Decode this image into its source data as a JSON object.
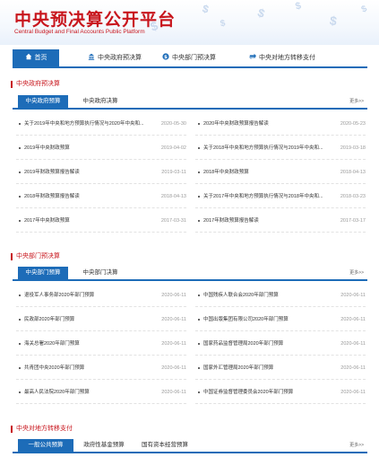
{
  "header": {
    "title": "中央预决算公开平台",
    "subtitle": "Central Budget and Final Accounts Public Platform",
    "colors": {
      "brand_red": "#c8161d",
      "accent_blue": "#1d6cb8"
    }
  },
  "nav": [
    {
      "label": "首页",
      "icon": "home-icon"
    },
    {
      "label": "中央政府预决算",
      "icon": "building-icon"
    },
    {
      "label": "中央部门预决算",
      "icon": "dollar-circle-icon"
    },
    {
      "label": "中央对地方转移支付",
      "icon": "transfer-icon"
    }
  ],
  "sections": {
    "gov": {
      "title": "中央政府预决算",
      "tabs": [
        "中央政府预算",
        "中央政府决算"
      ],
      "more": "更多>>",
      "rows": [
        [
          {
            "text": "关于2019年中央和地方预算执行情况与2020年中央和...",
            "date": "2020-05-30"
          },
          {
            "text": "2020年中央财政预算报告解读",
            "date": "2020-05-23"
          }
        ],
        [
          {
            "text": "2019年中央财政预算",
            "date": "2019-04-02"
          },
          {
            "text": "关于2018年中央和地方预算执行情况与2019年中央和...",
            "date": "2019-03-18"
          }
        ],
        [
          {
            "text": "2019年财政预算报告解读",
            "date": "2019-03-11"
          },
          {
            "text": "2018年中央财政预算",
            "date": "2018-04-13"
          }
        ],
        [
          {
            "text": "2018年财政预算报告解读",
            "date": "2018-04-13"
          },
          {
            "text": "关于2017年中央和地方预算执行情况与2018年中央和...",
            "date": "2018-03-23"
          }
        ],
        [
          {
            "text": "2017年中央财政预算",
            "date": "2017-03-31"
          },
          {
            "text": "2017年财政预算报告解读",
            "date": "2017-03-17"
          }
        ]
      ]
    },
    "dept": {
      "title": "中央部门预决算",
      "tabs": [
        "中央部门预算",
        "中央部门决算"
      ],
      "more": "更多>>",
      "rows": [
        [
          {
            "text": "退役军人事务部2020年部门预算",
            "date": "2020-06-11"
          },
          {
            "text": "中国残疾人联合会2020年部门预算",
            "date": "2020-06-11"
          }
        ],
        [
          {
            "text": "民政部2020年部门预算",
            "date": "2020-06-11"
          },
          {
            "text": "中国出版集团有限公司2020年部门预算",
            "date": "2020-06-11"
          }
        ],
        [
          {
            "text": "海关总署2020年部门预算",
            "date": "2020-06-11"
          },
          {
            "text": "国家药品监督管理局2020年部门预算",
            "date": "2020-06-11"
          }
        ],
        [
          {
            "text": "共青团中央2020年部门预算",
            "date": "2020-06-11"
          },
          {
            "text": "国家外汇管理局2020年部门预算",
            "date": "2020-06-11"
          }
        ],
        [
          {
            "text": "最高人民法院2020年部门预算",
            "date": "2020-06-11"
          },
          {
            "text": "中国证券监督管理委员会2020年部门预算",
            "date": "2020-06-11"
          }
        ]
      ]
    },
    "transfer": {
      "title": "中央对地方转移支付",
      "tabs": [
        "一般公共预算",
        "政府性基金预算",
        "国有资本经营预算"
      ],
      "more": "更多>>"
    }
  }
}
